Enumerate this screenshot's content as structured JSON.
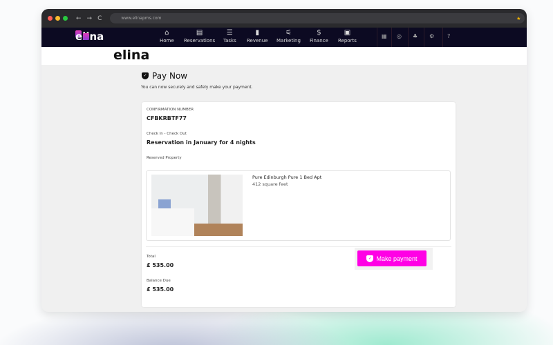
{
  "browser": {
    "url": "www.elinapms.com"
  },
  "nav": {
    "logo": "elina",
    "items": [
      {
        "label": "Home",
        "icon": "⌂"
      },
      {
        "label": "Reservations",
        "icon": "▤"
      },
      {
        "label": "Tasks",
        "icon": "☰"
      },
      {
        "label": "Revenue",
        "icon": "▮"
      },
      {
        "label": "Marketing",
        "icon": "⚟"
      },
      {
        "label": "Finance",
        "icon": "$"
      },
      {
        "label": "Reports",
        "icon": "▣"
      }
    ],
    "right_icons": [
      "▦",
      "◎",
      "♣",
      "⚙",
      "?"
    ]
  },
  "brand": "elina",
  "page": {
    "title": "Pay Now",
    "subtitle": "You can now securely and safely make your payment."
  },
  "booking": {
    "confirmation_label": "CONFIRMATION NUMBER",
    "confirmation": "CFBKRBTF77",
    "dates_label": "Check In - Check Out",
    "dates": "Reservation in January for 4 nights",
    "property_label": "Reserved Property",
    "property_name": "Pure Edinburgh Pure 1 Bed Apt",
    "property_size": "412 square feet",
    "total_label": "Total",
    "total": "£ 535.00",
    "balance_label": "Balance Due",
    "balance": "£ 535.00"
  },
  "actions": {
    "pay": "Make payment"
  }
}
